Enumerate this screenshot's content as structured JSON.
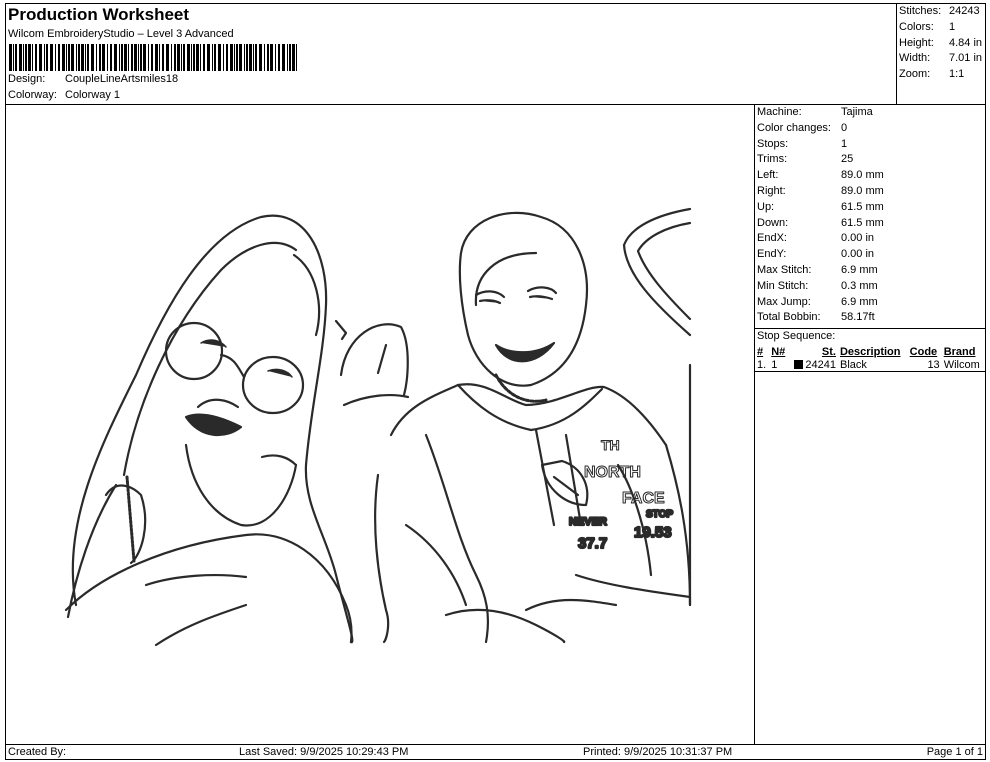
{
  "header": {
    "title": "Production Worksheet",
    "subtitle": "Wilcom EmbroideryStudio – Level 3 Advanced",
    "design_label": "Design:",
    "design_value": "CoupleLineArtsmiles18",
    "colorway_label": "Colorway:",
    "colorway_value": "Colorway 1"
  },
  "stats": [
    {
      "label": "Stitches:",
      "value": "24243"
    },
    {
      "label": "Colors:",
      "value": "1"
    },
    {
      "label": "Height:",
      "value": "4.84 in"
    },
    {
      "label": "Width:",
      "value": "7.01 in"
    },
    {
      "label": "Zoom:",
      "value": "1:1"
    }
  ],
  "machine_info": [
    {
      "label": "Machine:",
      "value": "Tajima"
    },
    {
      "label": "Color changes:",
      "value": "0"
    },
    {
      "label": "Stops:",
      "value": "1"
    },
    {
      "label": "Trims:",
      "value": "25"
    },
    {
      "label": "Left:",
      "value": "89.0 mm"
    },
    {
      "label": "Right:",
      "value": "89.0 mm"
    },
    {
      "label": "Up:",
      "value": "61.5 mm"
    },
    {
      "label": "Down:",
      "value": "61.5 mm"
    },
    {
      "label": "EndX:",
      "value": "0.00 in"
    },
    {
      "label": "EndY:",
      "value": "0.00 in"
    },
    {
      "label": "Max Stitch:",
      "value": "6.9 mm"
    },
    {
      "label": "Min Stitch:",
      "value": "0.3 mm"
    },
    {
      "label": "Max Jump:",
      "value": "6.9 mm"
    },
    {
      "label": "Total Bobbin:",
      "value": "58.17ft"
    }
  ],
  "stop_sequence": {
    "title": "Stop Sequence:",
    "columns": [
      "#",
      "N#",
      "St.",
      "Description",
      "Code",
      "Brand"
    ],
    "rows": [
      {
        "num": "1.",
        "n": "1",
        "stitches": "24241",
        "description": "Black",
        "code": "13",
        "brand": "Wilcom",
        "color": "#000000"
      }
    ]
  },
  "design_artwork": {
    "embroidery_lettering": [
      "TH",
      "NORTH",
      "FACE",
      "NEVER",
      "STOP",
      "37.7",
      "19.53"
    ]
  },
  "footer": {
    "created_by": "Created By:",
    "last_saved": "Last Saved: 9/9/2025 10:29:43 PM",
    "printed": "Printed: 9/9/2025 10:31:37 PM",
    "page": "Page 1 of 1"
  }
}
